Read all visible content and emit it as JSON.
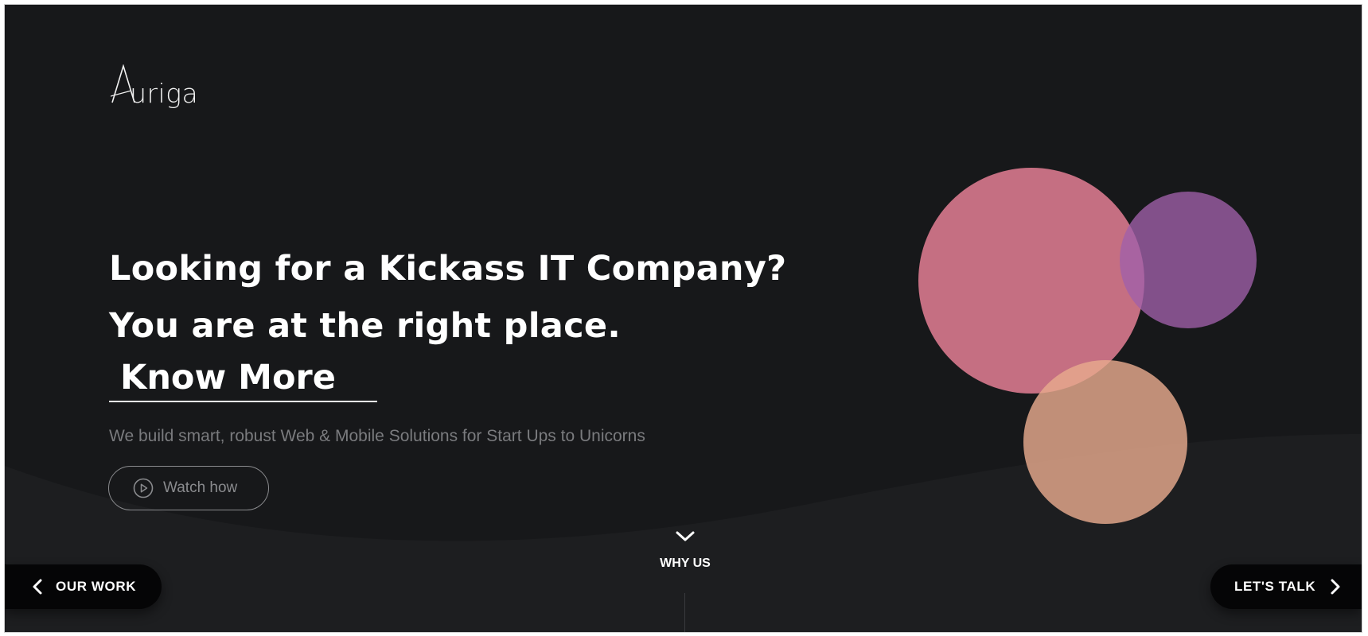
{
  "brand": {
    "logo_text": "Auriga"
  },
  "hero": {
    "headline_line1": "Looking for a Kickass IT Company?",
    "headline_line2": "You are at the right place.",
    "cta_label": "Know More",
    "subtitle": "We build smart, robust Web & Mobile Solutions for Start Ups to Unicorns",
    "watch_label": "Watch how"
  },
  "decoration": {
    "circle_colors": [
      "#cd7386",
      "#9a64a2",
      "#d59a84"
    ]
  },
  "footer_nav": {
    "left_label": "OUR WORK",
    "center_label": "WHY US",
    "right_label": "LET'S TALK"
  },
  "icons": {
    "play": "play-circle-icon",
    "chevron_down": "chevron-down-icon",
    "chevron_left": "chevron-left-icon",
    "chevron_right": "chevron-right-icon"
  },
  "colors": {
    "background": "#17181a",
    "text": "#ffffff",
    "muted": "#7a7b7e"
  }
}
